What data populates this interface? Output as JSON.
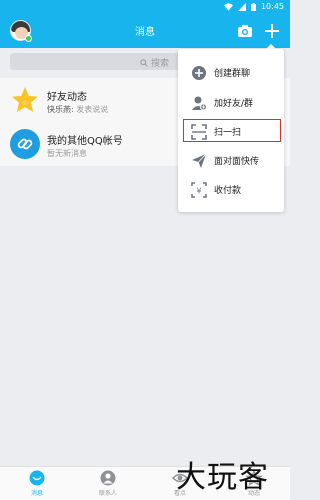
{
  "status": {
    "time": "10:45"
  },
  "header": {
    "title": "消息"
  },
  "search": {
    "placeholder": "搜索"
  },
  "conversations": [
    {
      "title": "好友动态",
      "sub_name": "快乐燕:",
      "sub_text": "发表说说"
    },
    {
      "title": "我的其他QQ帐号",
      "sub_text": "暂无新消息"
    }
  ],
  "menu": {
    "items": [
      {
        "label": "创建群聊",
        "icon": "create-group-icon"
      },
      {
        "label": "加好友/群",
        "icon": "add-friend-icon"
      },
      {
        "label": "扫一扫",
        "icon": "scan-icon"
      },
      {
        "label": "面对面快传",
        "icon": "send-icon"
      },
      {
        "label": "收付款",
        "icon": "payment-icon"
      }
    ],
    "highlighted": "扫一扫"
  },
  "bottom_nav": [
    {
      "label": "消息",
      "active": true
    },
    {
      "label": "联系人"
    },
    {
      "label": "看点"
    },
    {
      "label": "动态"
    }
  ],
  "watermark": "大玩客",
  "colors": {
    "accent": "#18b4ed",
    "highlight_border": "#d9312a"
  }
}
